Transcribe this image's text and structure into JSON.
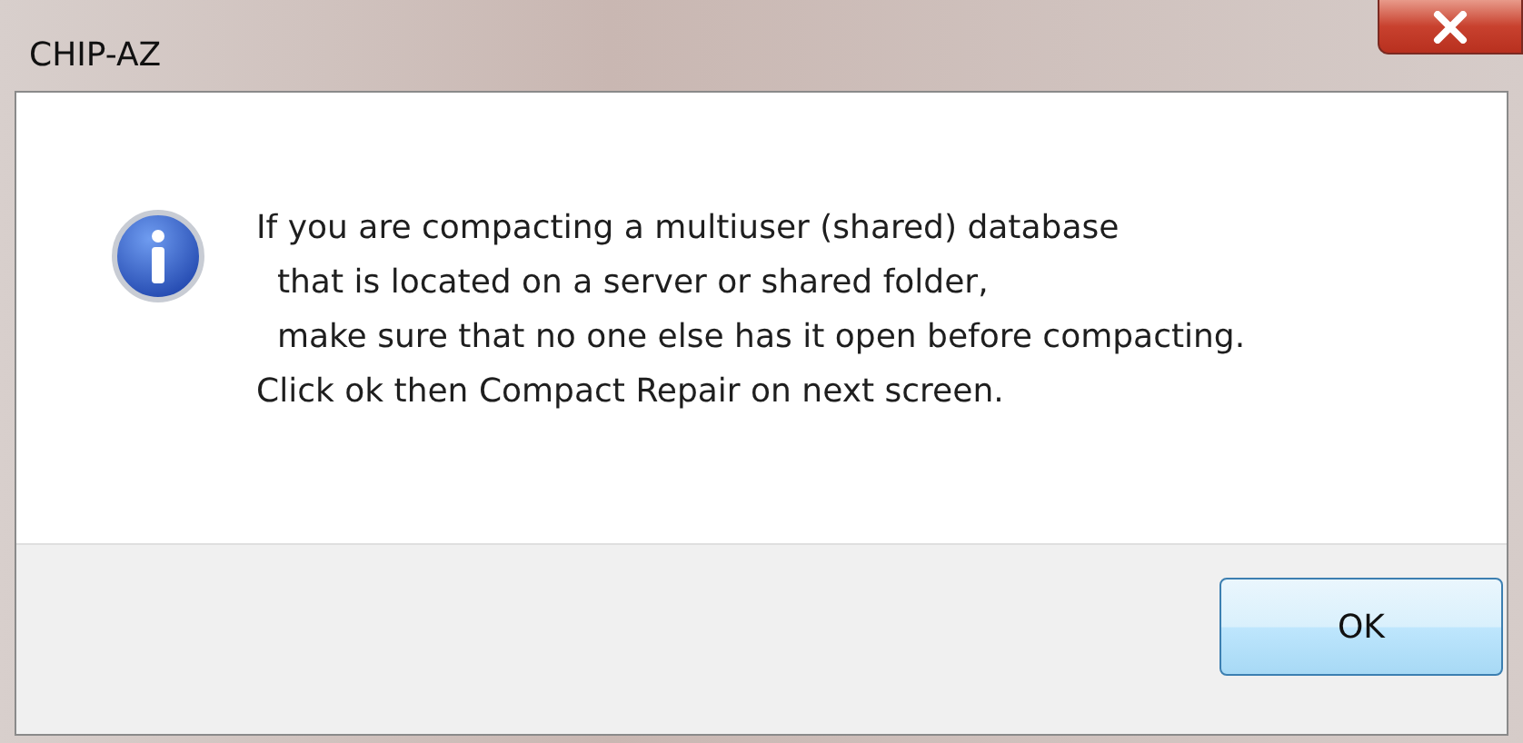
{
  "window": {
    "title": "CHIP-AZ"
  },
  "message": "If you are compacting a multiuser (shared) database\n  that is located on a server or shared folder,\n  make sure that no one else has it open before compacting.\nClick ok then Compact Repair on next screen.",
  "buttons": [
    "OK"
  ]
}
